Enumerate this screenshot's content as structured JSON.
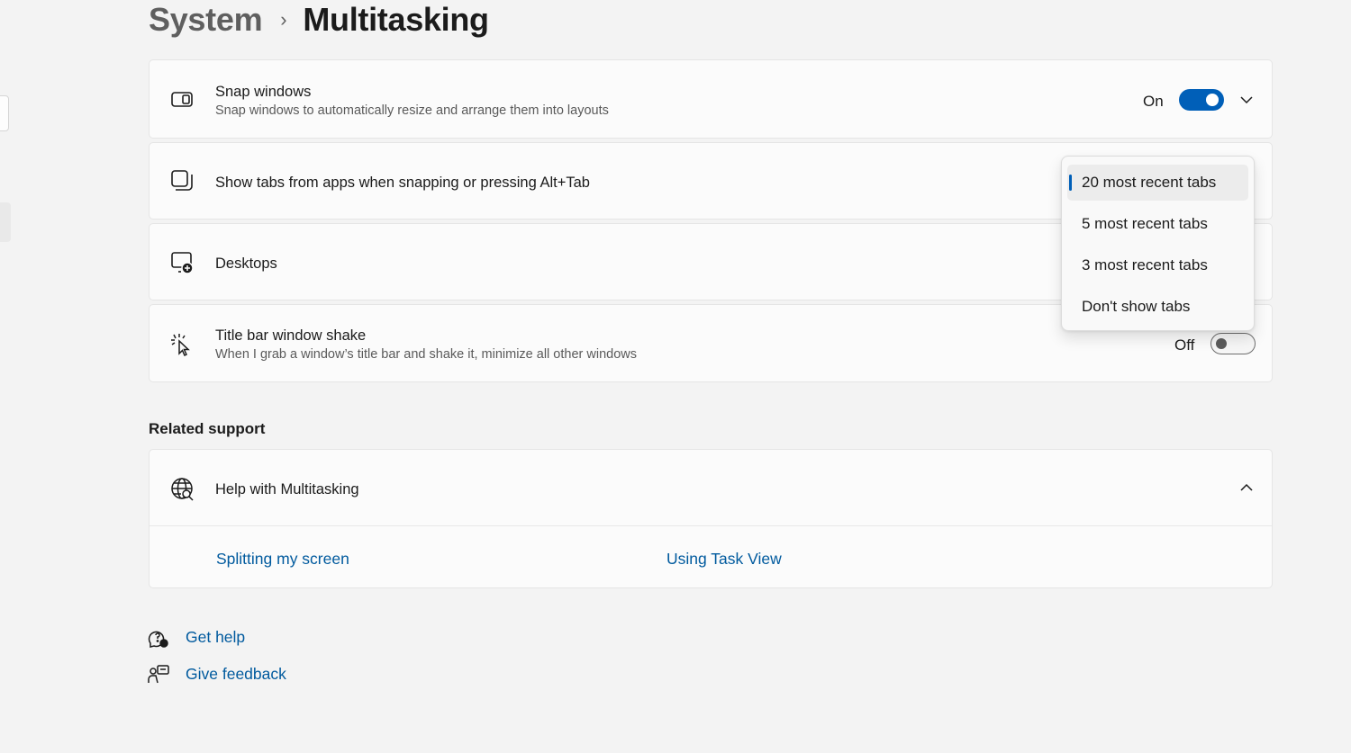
{
  "breadcrumb": {
    "parent": "System",
    "current": "Multitasking"
  },
  "settings": {
    "snap_windows": {
      "title": "Snap windows",
      "description": "Snap windows to automatically resize and arrange them into layouts",
      "state": "On",
      "icon": "snap-windows-icon"
    },
    "show_tabs": {
      "title": "Show tabs from apps when snapping or pressing Alt+Tab",
      "icon": "tabs-icon"
    },
    "desktops": {
      "title": "Desktops",
      "icon": "desktops-icon"
    },
    "title_bar_shake": {
      "title": "Title bar window shake",
      "description": "When I grab a window’s title bar and shake it, minimize all other windows",
      "state": "Off",
      "icon": "shake-cursor-icon"
    }
  },
  "dropdown": {
    "options": [
      "20 most recent tabs",
      "5 most recent tabs",
      "3 most recent tabs",
      "Don't show tabs"
    ],
    "selected": "20 most recent tabs"
  },
  "related_support": {
    "heading": "Related support",
    "help_title": "Help with Multitasking",
    "links": [
      "Splitting my screen",
      "Using Task View"
    ]
  },
  "footer": {
    "get_help": "Get help",
    "give_feedback": "Give feedback"
  },
  "colors": {
    "accent": "#005fb8",
    "link": "#005a9e"
  }
}
